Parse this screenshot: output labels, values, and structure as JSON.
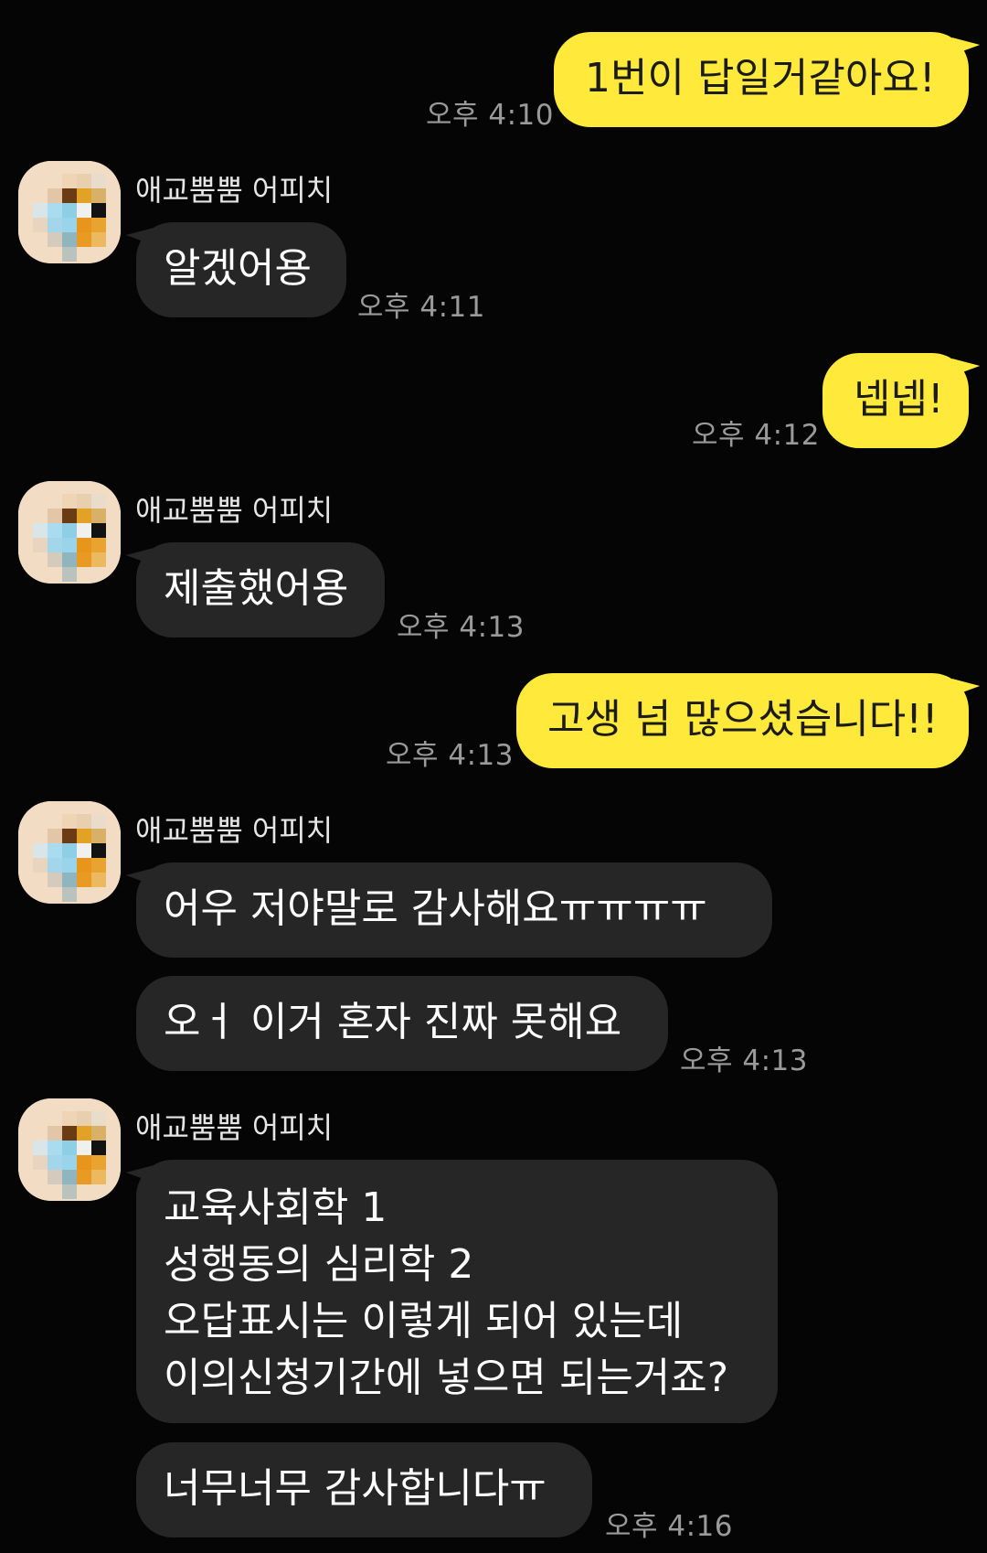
{
  "messages": [
    {
      "text": "1번이 답일거같아요!",
      "time": "오후 4:10"
    },
    {
      "sender": "애교뿜뿜 어피치",
      "text": "알겠어용",
      "time": "오후 4:11"
    },
    {
      "text": "넵넵!",
      "time": "오후 4:12"
    },
    {
      "sender": "애교뿜뿜 어피치",
      "text": "제출했어용",
      "time": "오후 4:13"
    },
    {
      "text": "고생 넘 많으셨습니다!!",
      "time": "오후 4:13"
    },
    {
      "sender": "애교뿜뿜 어피치",
      "text": "어우 저야말로 감사해요ㅠㅠㅠㅠ"
    },
    {
      "text": "오ㅓ 이거 혼자 진짜 못해요",
      "time": "오후 4:13"
    },
    {
      "sender": "애교뿜뿜 어피치",
      "lines": [
        "교육사회학 1",
        "성행동의 심리학 2",
        "오답표시는 이렇게 되어 있는데",
        "이의신청기간에 넣으면 되는거죠?"
      ]
    },
    {
      "text": "너무너무 감사합니다ㅠ",
      "time": "오후 4:16"
    }
  ],
  "theme": {
    "my_bubble": "#ffe93a",
    "other_bubble": "#262626",
    "background": "#050505"
  },
  "icons": {
    "avatar": "pixelated-avatar-icon"
  }
}
